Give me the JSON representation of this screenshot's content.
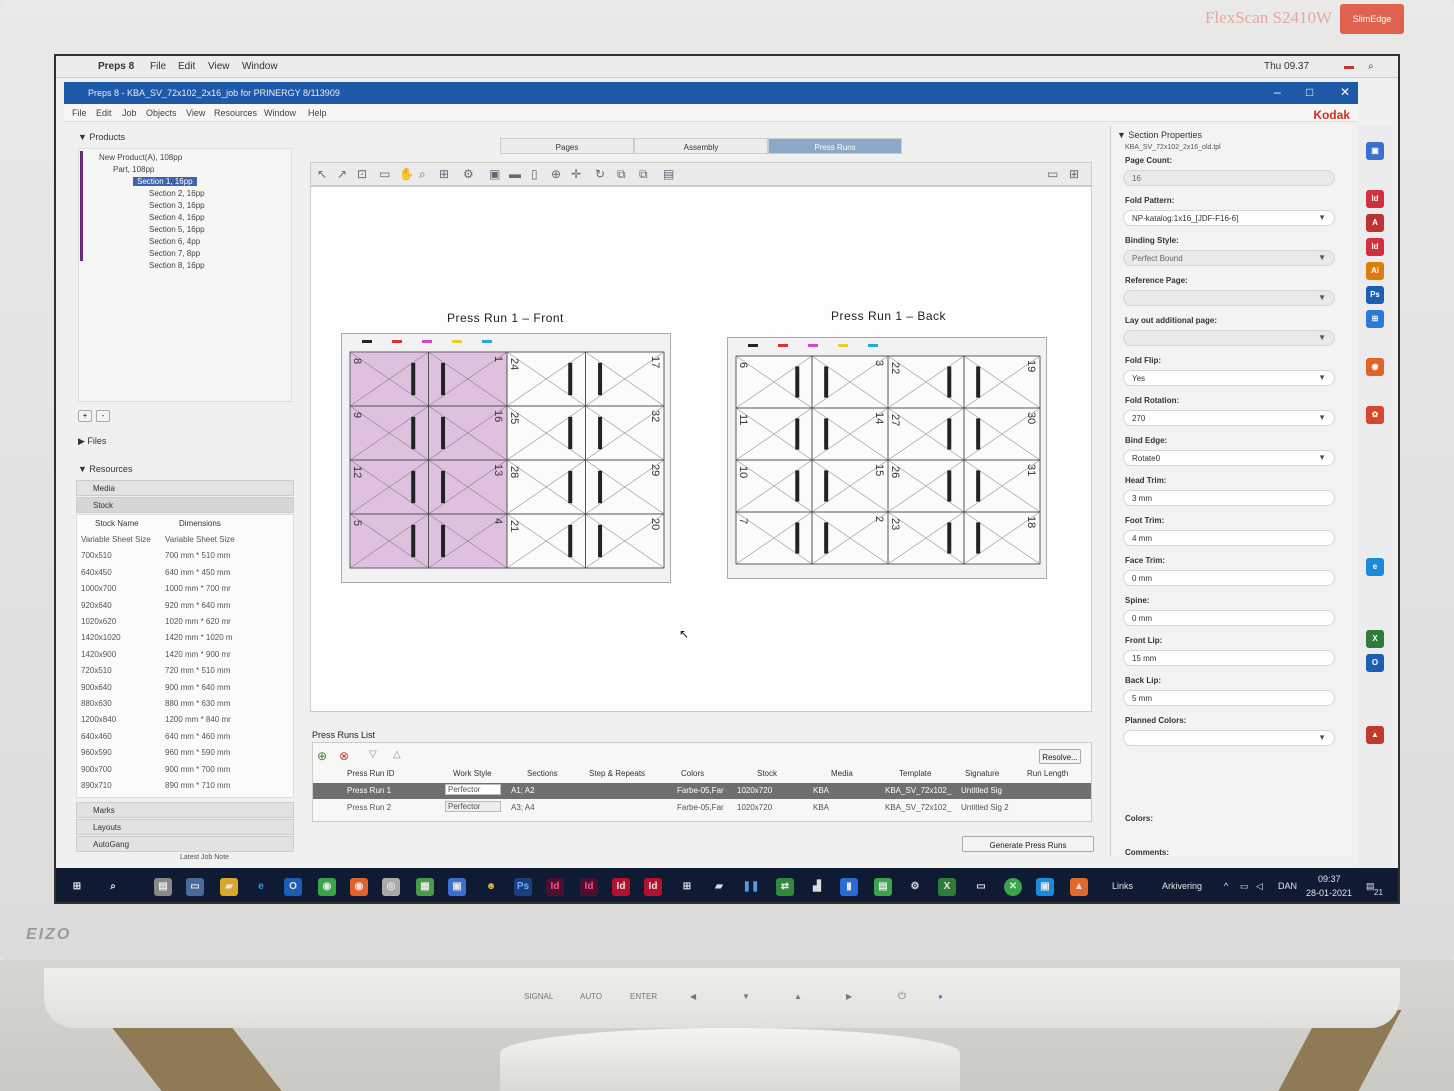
{
  "monitor": {
    "model": "FlexScan S2410W",
    "badge": "SlimEdge",
    "brand": "EIZO",
    "buttons": [
      "SIGNAL",
      "AUTO",
      "ENTER",
      "◀",
      "▼",
      "▲",
      "▶",
      "⏻",
      "●"
    ]
  },
  "mac_menu": {
    "apple": "",
    "app": "Preps 8",
    "items": [
      "File",
      "Edit",
      "View",
      "Window"
    ],
    "clock": "Thu 09.37"
  },
  "window": {
    "title": "Preps 8 - KBA_SV_72x102_2x16_job for PRINERGY 8/113909",
    "menu": [
      "File",
      "Edit",
      "Job",
      "Objects",
      "View",
      "Resources",
      "Window",
      "Help"
    ],
    "kodak": "Kodak"
  },
  "products": {
    "header": "Products",
    "root": "New Product(A), 108pp",
    "part": "Part, 108pp",
    "sections": [
      "Section 1, 16pp",
      "Section 2, 16pp",
      "Section 3, 16pp",
      "Section 4, 16pp",
      "Section 5, 16pp",
      "Section 6, 4pp",
      "Section 7, 8pp",
      "Section 8, 16pp"
    ]
  },
  "files_header": "Files",
  "resources": {
    "header": "Resources",
    "tabs": [
      "Media",
      "Stock"
    ],
    "columns": [
      "Stock Name",
      "Dimensions"
    ],
    "rows": [
      [
        "Variable Sheet Size",
        "Variable Sheet Size"
      ],
      [
        "700x510",
        "700 mm * 510 mm"
      ],
      [
        "640x450",
        "640 mm * 450 mm"
      ],
      [
        "1000x700",
        "1000 mm * 700 mr"
      ],
      [
        "920x640",
        "920 mm * 640 mm"
      ],
      [
        "1020x620",
        "1020 mm * 620 mr"
      ],
      [
        "1420x1020",
        "1420 mm * 1020 m"
      ],
      [
        "1420x900",
        "1420 mm * 900 mr"
      ],
      [
        "720x510",
        "720 mm * 510 mm"
      ],
      [
        "900x640",
        "900 mm * 640 mm"
      ],
      [
        "880x630",
        "880 mm * 630 mm"
      ],
      [
        "1200x840",
        "1200 mm * 840 mr"
      ],
      [
        "640x460",
        "640 mm * 460 mm"
      ],
      [
        "960x590",
        "960 mm * 590 mm"
      ],
      [
        "900x700",
        "900 mm * 700 mm"
      ],
      [
        "890x710",
        "890 mm * 710 mm"
      ]
    ],
    "bottom_tabs": [
      "Marks",
      "Layouts",
      "AutoGang"
    ],
    "latest_job_note": "Latest Job Note"
  },
  "view_tabs": [
    "Pages",
    "Assembly",
    "Press Runs"
  ],
  "press_runs": {
    "front_title": "Press Run 1 – Front",
    "back_title": "Press Run 1 – Back",
    "front_numbers": [
      "8",
      "1",
      "24",
      "17",
      "9",
      "16",
      "25",
      "32",
      "12",
      "13",
      "28",
      "29",
      "5",
      "4",
      "21",
      "20"
    ],
    "back_numbers": [
      "6",
      "3",
      "22",
      "19",
      "11",
      "14",
      "27",
      "30",
      "10",
      "15",
      "26",
      "31",
      "7",
      "2",
      "23",
      "18"
    ]
  },
  "press_runs_list": {
    "title": "Press Runs List",
    "resolve": "Resolve...",
    "columns": [
      "Press Run ID",
      "Work Style",
      "Sections",
      "Step & Repeats",
      "Colors",
      "Stock",
      "Media",
      "Template",
      "Signature",
      "Run Length"
    ],
    "rows": [
      [
        "Press Run 1",
        "Perfector",
        "A1; A2",
        "",
        "Farbe-05,Far",
        "1020x720",
        "KBA",
        "KBA_SV_72x102_",
        "Untitled Sig",
        ""
      ],
      [
        "Press Run 2",
        "Perfector",
        "A3; A4",
        "",
        "Farbe-05,Far",
        "1020x720",
        "KBA",
        "KBA_SV_72x102_",
        "Untitled Sig 2",
        ""
      ]
    ],
    "generate": "Generate Press Runs"
  },
  "section_properties": {
    "header": "Section Properties",
    "template_file": "KBA_SV_72x102_2x16_old.tpl",
    "fields": [
      {
        "label": "Page Count:",
        "value": "16",
        "disabled": true,
        "dropdown": false
      },
      {
        "label": "Fold Pattern:",
        "value": "NP-katalog:1x16_[JDF-F16-6]",
        "disabled": false,
        "dropdown": true
      },
      {
        "label": "Binding Style:",
        "value": "Perfect Bound",
        "disabled": true,
        "dropdown": true
      },
      {
        "label": "Reference Page:",
        "value": "",
        "disabled": true,
        "dropdown": true
      },
      {
        "label": "Lay out additional page:",
        "value": "",
        "disabled": true,
        "dropdown": true
      },
      {
        "label": "Fold Flip:",
        "value": "Yes",
        "disabled": false,
        "dropdown": true
      },
      {
        "label": "Fold Rotation:",
        "value": "270",
        "disabled": false,
        "dropdown": true
      },
      {
        "label": "Bind Edge:",
        "value": "Rotate0",
        "disabled": false,
        "dropdown": true
      },
      {
        "label": "Head Trim:",
        "value": "3 mm",
        "disabled": false,
        "dropdown": false
      },
      {
        "label": "Foot Trim:",
        "value": "4 mm",
        "disabled": false,
        "dropdown": false
      },
      {
        "label": "Face Trim:",
        "value": "0 mm",
        "disabled": false,
        "dropdown": false
      },
      {
        "label": "Spine:",
        "value": "0 mm",
        "disabled": false,
        "dropdown": false
      },
      {
        "label": "Front Lip:",
        "value": "15 mm",
        "disabled": false,
        "dropdown": false
      },
      {
        "label": "Back Lip:",
        "value": "5 mm",
        "disabled": false,
        "dropdown": false
      },
      {
        "label": "Planned Colors:",
        "value": "",
        "disabled": false,
        "dropdown": true
      }
    ],
    "colors_label": "Colors:",
    "comments_label": "Comments:"
  },
  "taskbar": {
    "links": "Links",
    "arkivering": "Arkivering",
    "lang": "DAN",
    "time": "09:37",
    "date": "28-01-2021",
    "notif": "21"
  }
}
